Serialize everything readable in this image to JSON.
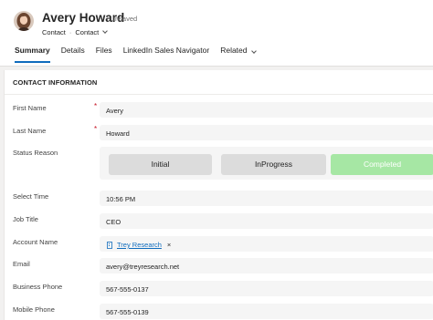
{
  "header": {
    "name": "Avery Howard",
    "status": "- Unsaved",
    "entity": "Contact",
    "separator": "·",
    "form": "Contact",
    "tabs": [
      {
        "label": "Summary",
        "active": true
      },
      {
        "label": "Details"
      },
      {
        "label": "Files"
      },
      {
        "label": "LinkedIn Sales Navigator"
      },
      {
        "label": "Related"
      }
    ]
  },
  "section": {
    "title": "CONTACT INFORMATION"
  },
  "fields": {
    "first_name": {
      "label": "First Name",
      "value": "Avery",
      "required_mark": "*"
    },
    "last_name": {
      "label": "Last Name",
      "value": "Howard",
      "required_mark": "*"
    },
    "status_reason": {
      "label": "Status Reason",
      "stages": [
        "Initial",
        "InProgress",
        "Completed"
      ],
      "selected": "Completed"
    },
    "select_time": {
      "label": "Select Time",
      "value": "10:56 PM"
    },
    "job_title": {
      "label": "Job Title",
      "value": "CEO"
    },
    "account_name": {
      "label": "Account Name",
      "value": "Trey Research",
      "remove": "×"
    },
    "email": {
      "label": "Email",
      "value": "avery@treyresearch.net"
    },
    "business_phone": {
      "label": "Business Phone",
      "value": "567-555-0137"
    },
    "mobile_phone": {
      "label": "Mobile Phone",
      "value": "567-555-0139"
    }
  },
  "colors": {
    "accent": "#0f6cbd",
    "completed": "#a6e7a4",
    "required": "#c50f1f"
  },
  "icons": {
    "avatar": "avatar",
    "account": "account-entity-icon"
  }
}
